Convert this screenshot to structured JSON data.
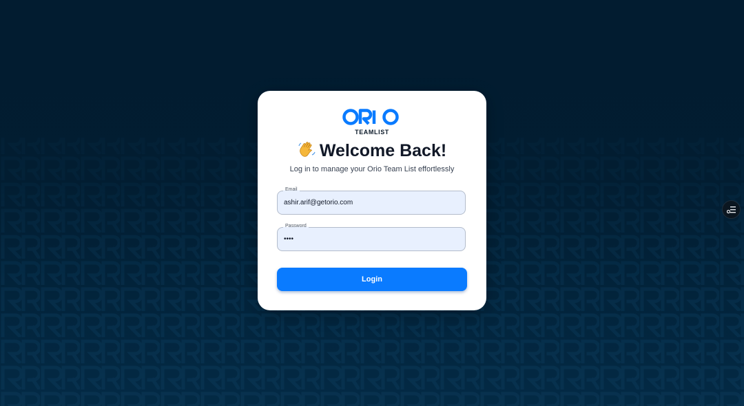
{
  "brand": {
    "name": "ORIO",
    "product": "TEAMLIST",
    "accent_color": "#0a7bff",
    "dark_color": "#0d1b2a",
    "background_color": "#021d31"
  },
  "login": {
    "title": "Welcome Back!",
    "title_icon": "waving-hand-icon",
    "subtitle": "Log in to manage your Orio Team List effortlessly",
    "email": {
      "label": "Email",
      "value": "ashir.arif@getorio.com"
    },
    "password": {
      "label": "Password",
      "value": "abcd"
    },
    "button_label": "Login"
  },
  "side_widget": {
    "icon": "settings-list-icon"
  }
}
